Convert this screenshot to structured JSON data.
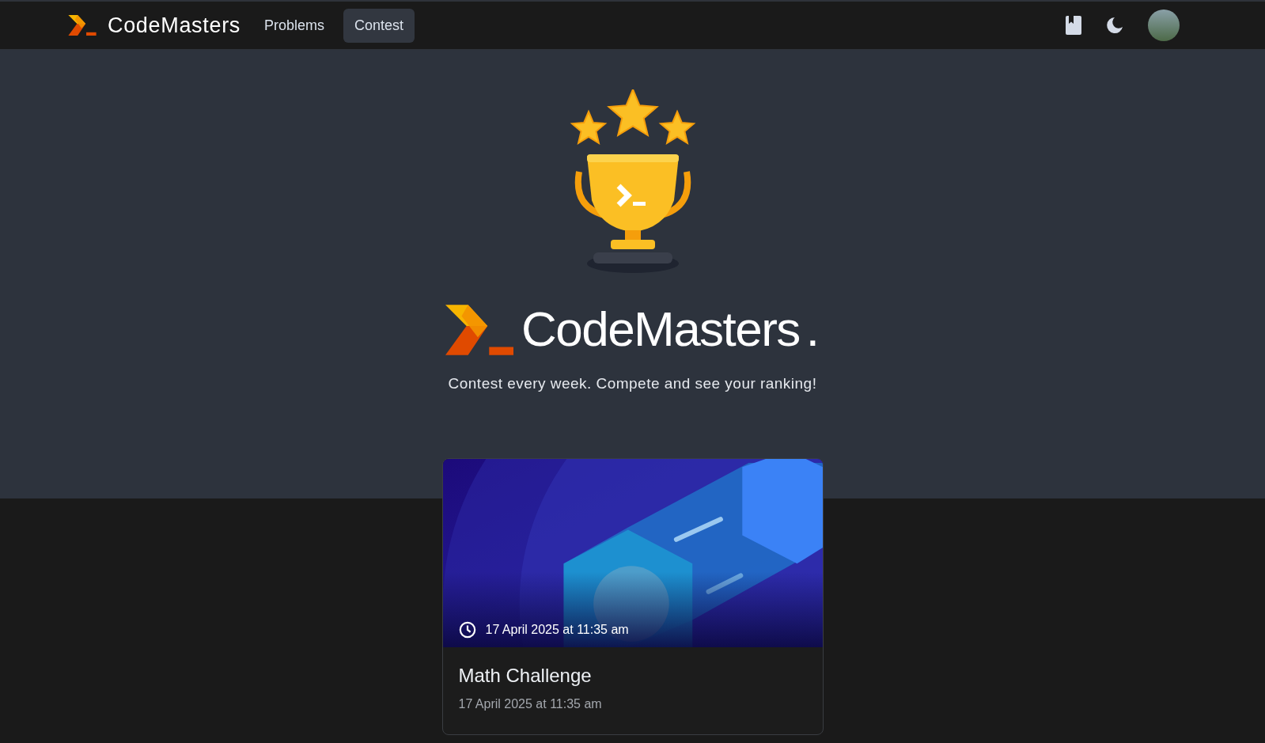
{
  "navbar": {
    "brand": "CodeMasters",
    "links": [
      {
        "label": "Problems",
        "selected": false
      },
      {
        "label": "Contest",
        "selected": true
      }
    ]
  },
  "hero": {
    "brand": "CodeMasters",
    "brand_dot": ".",
    "tagline": "Contest every week. Compete and see your ranking!"
  },
  "contests": [
    {
      "title": "Math Challenge",
      "overlay_time": "17 April 2025 at 11:35 am",
      "time": "17 April 2025 at 11:35 am"
    }
  ]
}
